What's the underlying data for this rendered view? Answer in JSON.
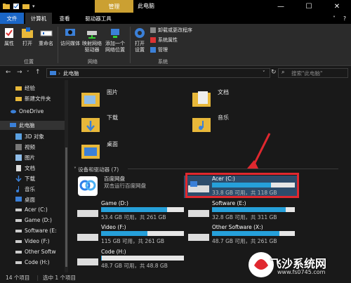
{
  "window": {
    "title": "此电脑",
    "manage_tab": "管理",
    "controls": [
      "—",
      "☐",
      "✕"
    ]
  },
  "tabs": {
    "file": "文件",
    "computer": "计算机",
    "view": "查看",
    "drive_tools": "驱动器工具"
  },
  "ribbon": {
    "location": {
      "label": "位置",
      "properties": "属性",
      "open": "打开",
      "rename": "重命名"
    },
    "network": {
      "label": "网络",
      "access_media": "访问媒体",
      "map_drive": "映射网络\n驱动器",
      "add_location": "添加一个\n网络位置"
    },
    "system": {
      "label": "系统",
      "open_settings": "打开\n设置",
      "uninstall": "卸载或更改程序",
      "system_properties": "系统属性",
      "manage": "管理"
    }
  },
  "address": {
    "path": "此电脑",
    "search_placeholder": "搜索\"此电脑\""
  },
  "nav": {
    "items": [
      {
        "label": "经验",
        "icon": "folder-icon"
      },
      {
        "label": "新建文件夹",
        "icon": "folder-icon"
      },
      {
        "label": "OneDrive",
        "icon": "onedrive-icon"
      },
      {
        "label": "此电脑",
        "icon": "computer-icon"
      },
      {
        "label": "3D 对象",
        "icon": "3d-objects-icon"
      },
      {
        "label": "视频",
        "icon": "video-icon"
      },
      {
        "label": "图片",
        "icon": "pictures-icon"
      },
      {
        "label": "文档",
        "icon": "documents-icon"
      },
      {
        "label": "下载",
        "icon": "download-icon"
      },
      {
        "label": "音乐",
        "icon": "music-icon"
      },
      {
        "label": "桌面",
        "icon": "desktop-icon"
      },
      {
        "label": "Acer (C:)",
        "icon": "drive-icon"
      },
      {
        "label": "Game (D:)",
        "icon": "drive-icon"
      },
      {
        "label": "Software (E:",
        "icon": "drive-icon"
      },
      {
        "label": "Video (F:)",
        "icon": "drive-icon"
      },
      {
        "label": "Other Softw",
        "icon": "drive-icon"
      },
      {
        "label": "Code (H:)",
        "icon": "drive-icon"
      }
    ]
  },
  "folders": [
    {
      "label": "图片",
      "icon": "pictures-folder-icon"
    },
    {
      "label": "文档",
      "icon": "documents-folder-icon"
    },
    {
      "label": "下载",
      "icon": "download-folder-icon"
    },
    {
      "label": "音乐",
      "icon": "music-folder-icon"
    },
    {
      "label": "桌面",
      "icon": "desktop-folder-icon"
    }
  ],
  "section_label": "设备和驱动器 (7)",
  "baidu": {
    "name": "百度网盘",
    "desc": "双击运行百度网盘"
  },
  "drives": [
    {
      "name": "Acer (C:)",
      "free": "33.8 GB 可用，共 118 GB",
      "used_fraction": 0.71
    },
    {
      "name": "Game (D:)",
      "free": "53.4 GB 可用，共 261 GB",
      "used_fraction": 0.8
    },
    {
      "name": "Software (E:)",
      "free": "32.8 GB 可用，共 311 GB",
      "used_fraction": 0.89
    },
    {
      "name": "Video (F:)",
      "free": "115 GB 可用，共 261 GB",
      "used_fraction": 0.56
    },
    {
      "name": "Other Software (X:)",
      "free": "48.7 GB 可用，共 261 GB",
      "used_fraction": 0.81
    },
    {
      "name": "Code (H:)",
      "free": "48.7 GB 可用，共 48.8 GB",
      "used_fraction": 0.01
    }
  ],
  "status": {
    "count": "14 个项目",
    "selected": "选中 1 个项目"
  },
  "watermark": {
    "brand": "飞沙系统网",
    "url": "www.fs0745.com"
  },
  "colors": {
    "accent": "#26a0da",
    "manage": "#cba032",
    "file_tab": "#1a66c6",
    "highlight": "#e0282f"
  }
}
